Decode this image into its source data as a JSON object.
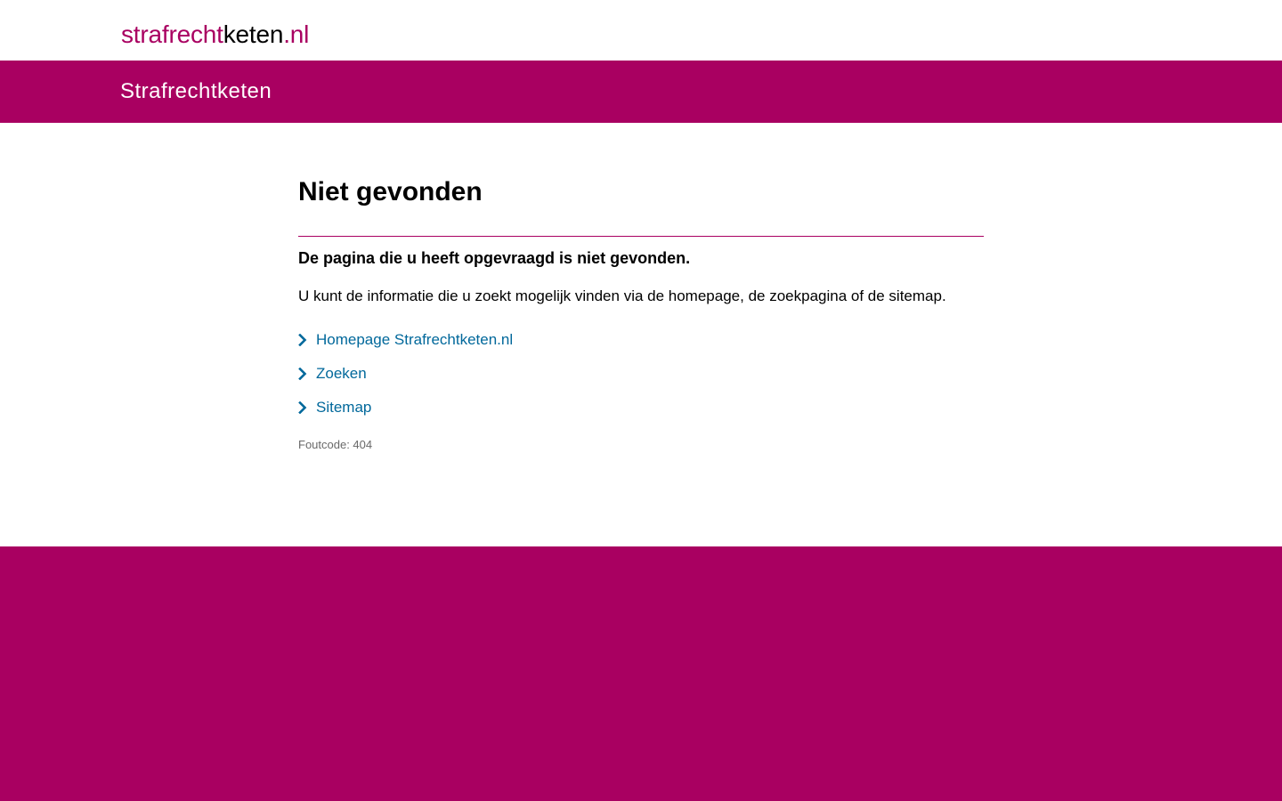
{
  "logo": {
    "part_a": "strafrecht",
    "part_b": "keten",
    "part_c": ".nl"
  },
  "header": {
    "site_name": "Strafrechtketen"
  },
  "main": {
    "title": "Niet gevonden",
    "lead": "De pagina die u heeft opgevraagd is niet gevonden.",
    "info": "U kunt de informatie die u zoekt mogelijk vinden via de homepage, de zoekpagina of de sitemap.",
    "links": [
      {
        "label": "Homepage Strafrechtketen.nl",
        "icon": "chevron-right-icon"
      },
      {
        "label": "Zoeken",
        "icon": "chevron-right-icon"
      },
      {
        "label": "Sitemap",
        "icon": "chevron-right-icon"
      }
    ],
    "error_code": "Foutcode: 404"
  },
  "colors": {
    "brand": "#a90061",
    "link": "#01689b",
    "muted": "#696969"
  }
}
